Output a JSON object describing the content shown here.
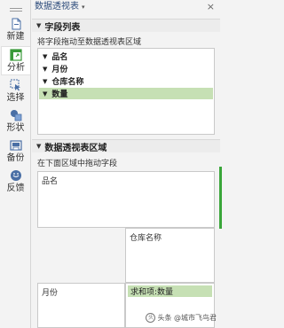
{
  "toolbar": {
    "items": [
      {
        "label": "新建",
        "icon": "new-file-icon"
      },
      {
        "label": "分析",
        "icon": "pivot-analysis-icon"
      },
      {
        "label": "选择",
        "icon": "select-cursor-icon"
      },
      {
        "label": "形状",
        "icon": "shapes-icon"
      },
      {
        "label": "备份",
        "icon": "backup-icon"
      },
      {
        "label": "反馈",
        "icon": "feedback-icon"
      }
    ],
    "active_label": "分析"
  },
  "panel": {
    "title": "数据透视表",
    "caret": "▾",
    "close": "×",
    "field_list": {
      "section_title": "字段列表",
      "hint": "将字段拖动至数据透视表区域",
      "fields": [
        {
          "label": "品名",
          "selected": false
        },
        {
          "label": "月份",
          "selected": false
        },
        {
          "label": "仓库名称",
          "selected": false
        },
        {
          "label": "数量",
          "selected": true
        }
      ]
    },
    "areas": {
      "section_title": "数据透视表区域",
      "hint": "在下面区域中拖动字段",
      "filter_zone": "品名",
      "column_zone": "仓库名称",
      "row_zone": "月份",
      "value_zone": "求和项:数量"
    }
  },
  "watermark": "头条 @城市飞鸟君",
  "colors": {
    "selected_highlight": "#c6e0b4",
    "side_handle": "#3aa63a",
    "title_text": "#2b4a7a"
  }
}
